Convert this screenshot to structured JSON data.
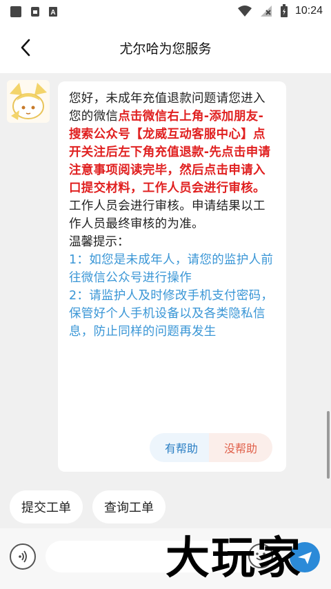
{
  "status_bar": {
    "time": "10:24",
    "icons": [
      "square-icon",
      "lock-icon",
      "font-a-icon",
      "wifi-icon",
      "no-signal-icon",
      "battery-charging-icon"
    ]
  },
  "header": {
    "title": "尤尔哈为您服务",
    "back_icon": "chevron-left-icon"
  },
  "message": {
    "avatar_icon": "anime-avatar",
    "intro": "您好，未成年充值退款问题请您进入您的微信",
    "highlight": "点击微信右上角-添加朋友-搜索公众号【龙威互动客服中心】点开关注后左下角充值退款-先点击申请注意事项阅读完毕，然后点击申请入口提交材料，工作人员会进行审核。",
    "outro": "工作人员会进行审核。申请结果以工作人员最终审核的为准。",
    "tips_title": "温馨提示：",
    "tip_1": "1：如您是未成年人，请您的监护人前往微信公众号进行操作",
    "tip_2": "2：请监护人及时修改手机支付密码，保管好个人手机设备以及各类隐私信息，防止同样的问题再发生",
    "feedback_yes": "有帮助",
    "feedback_no": "没帮助"
  },
  "quick_actions": [
    "提交工单",
    "查询工单"
  ],
  "input": {
    "placeholder": "",
    "voice_icon": "voice-icon",
    "emoji_icon": "emoji-icon",
    "send_icon": "send-icon"
  },
  "watermark": "大玩家",
  "colors": {
    "highlight_red": "#e02020",
    "tip_blue": "#3a96d6",
    "feedback_yes": "#2b7fc4",
    "feedback_no": "#e0604a"
  }
}
